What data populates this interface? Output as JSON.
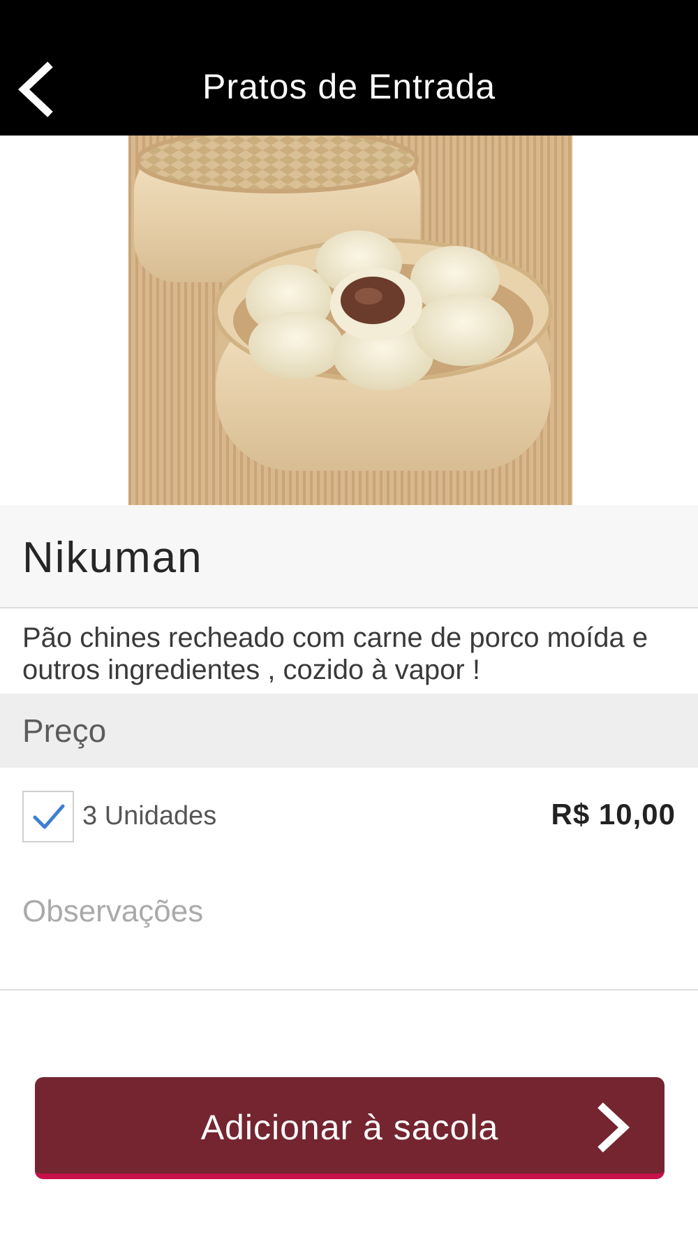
{
  "header": {
    "title": "Pratos de Entrada",
    "back_icon": "chevron-left-icon",
    "background": "#000000"
  },
  "product": {
    "image_alt": "Nikuman",
    "name": "Nikuman",
    "description": "Pão chines recheado com carne de porco moída e outros ingredientes , cozido à vapor !"
  },
  "price_section": {
    "label": "Preço",
    "options": [
      {
        "label": "3 Unidades",
        "price": "R$ 10,00",
        "checked": true
      }
    ]
  },
  "observations": {
    "placeholder": "Observações",
    "value": ""
  },
  "add_button": {
    "label": "Adicionar à sacola",
    "icon": "chevron-right-icon",
    "background": "#742530",
    "accent": "#c8104a"
  },
  "colors": {
    "checkmark": "#3f7fd1",
    "name_bg": "#f7f7f7",
    "price_header_bg": "#eeeeee"
  }
}
